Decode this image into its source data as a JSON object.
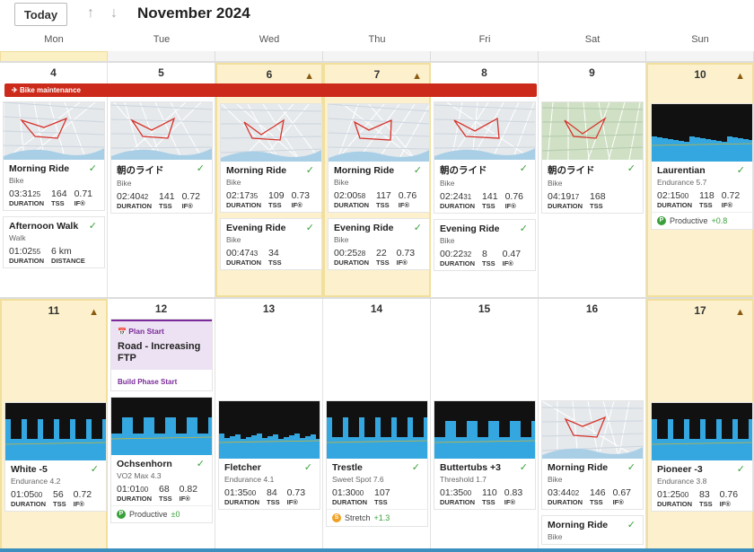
{
  "header": {
    "today_label": "Today",
    "up_icon": "arrow-up-icon",
    "down_icon": "arrow-down-icon",
    "month_title": "November 2024"
  },
  "weekdays": [
    "Mon",
    "Tue",
    "Wed",
    "Thu",
    "Fri",
    "Sat",
    "Sun"
  ],
  "colors": {
    "highlight": "#fcf1cc",
    "banner": "#cc2a1a",
    "plan": "#7a2a9a",
    "complete": "#3aa03a",
    "graph_fill": "#35a7e0"
  },
  "banner": {
    "icon": "plane-departure-icon",
    "label": "Bike maintenance"
  },
  "weeks": [
    {
      "days": [
        {
          "date": "4",
          "warning": false,
          "highlight": false,
          "items": [
            {
              "thumb": "map",
              "title": "Morning Ride",
              "subtitle": "Bike",
              "completed": true,
              "metrics": [
                {
                  "value": "03:31",
                  "sec": "25",
                  "label": "DURATION"
                },
                {
                  "value": "164",
                  "label": "TSS"
                },
                {
                  "value": "0.71",
                  "label": "IF®"
                }
              ]
            },
            {
              "thumb": "none",
              "title": "Afternoon Walk",
              "subtitle": "Walk",
              "completed": true,
              "metrics": [
                {
                  "value": "01:02",
                  "sec": "55",
                  "label": "DURATION"
                },
                {
                  "value": "6 km",
                  "label": "DISTANCE"
                }
              ]
            }
          ]
        },
        {
          "date": "5",
          "warning": false,
          "highlight": false,
          "items": [
            {
              "thumb": "map",
              "title": "朝のライド",
              "subtitle": "Bike",
              "completed": true,
              "metrics": [
                {
                  "value": "02:40",
                  "sec": "42",
                  "label": "DURATION"
                },
                {
                  "value": "141",
                  "label": "TSS"
                },
                {
                  "value": "0.72",
                  "label": "IF®"
                }
              ]
            }
          ]
        },
        {
          "date": "6",
          "warning": true,
          "highlight": true,
          "items": [
            {
              "thumb": "map",
              "title": "Morning Ride",
              "subtitle": "Bike",
              "completed": true,
              "metrics": [
                {
                  "value": "02:17",
                  "sec": "35",
                  "label": "DURATION"
                },
                {
                  "value": "109",
                  "label": "TSS"
                },
                {
                  "value": "0.73",
                  "label": "IF®"
                }
              ]
            },
            {
              "thumb": "none",
              "title": "Evening Ride",
              "subtitle": "Bike",
              "completed": true,
              "metrics": [
                {
                  "value": "00:47",
                  "sec": "43",
                  "label": "DURATION"
                },
                {
                  "value": "34",
                  "label": "TSS"
                }
              ]
            }
          ]
        },
        {
          "date": "7",
          "warning": true,
          "highlight": true,
          "items": [
            {
              "thumb": "map",
              "title": "Morning Ride",
              "subtitle": "Bike",
              "completed": true,
              "metrics": [
                {
                  "value": "02:00",
                  "sec": "58",
                  "label": "DURATION"
                },
                {
                  "value": "117",
                  "label": "TSS"
                },
                {
                  "value": "0.76",
                  "label": "IF®"
                }
              ]
            },
            {
              "thumb": "none",
              "title": "Evening Ride",
              "subtitle": "Bike",
              "completed": true,
              "metrics": [
                {
                  "value": "00:25",
                  "sec": "28",
                  "label": "DURATION"
                },
                {
                  "value": "22",
                  "label": "TSS"
                },
                {
                  "value": "0.73",
                  "label": "IF®"
                }
              ]
            }
          ]
        },
        {
          "date": "8",
          "warning": false,
          "highlight": false,
          "items": [
            {
              "thumb": "map",
              "title": "朝のライド",
              "subtitle": "Bike",
              "completed": true,
              "metrics": [
                {
                  "value": "02:24",
                  "sec": "31",
                  "label": "DURATION"
                },
                {
                  "value": "141",
                  "label": "TSS"
                },
                {
                  "value": "0.76",
                  "label": "IF®"
                }
              ]
            },
            {
              "thumb": "none",
              "title": "Evening Ride",
              "subtitle": "Bike",
              "completed": true,
              "metrics": [
                {
                  "value": "00:22",
                  "sec": "32",
                  "label": "DURATION"
                },
                {
                  "value": "8",
                  "label": "TSS"
                },
                {
                  "value": "0.47",
                  "label": "IF®"
                }
              ]
            }
          ]
        },
        {
          "date": "9",
          "warning": false,
          "highlight": false,
          "items": [
            {
              "thumb": "terrain",
              "title": "朝のライド",
              "subtitle": "Bike",
              "completed": true,
              "metrics": [
                {
                  "value": "04:19",
                  "sec": "17",
                  "label": "DURATION"
                },
                {
                  "value": "168",
                  "label": "TSS"
                }
              ]
            }
          ]
        },
        {
          "date": "10",
          "warning": true,
          "highlight": true,
          "items": [
            {
              "thumb": "graph",
              "title": "Laurentian",
              "subtitle": "Endurance 5.7",
              "completed": true,
              "metrics": [
                {
                  "value": "02:15",
                  "sec": "00",
                  "label": "DURATION"
                },
                {
                  "value": "118",
                  "label": "TSS"
                },
                {
                  "value": "0.72",
                  "label": "IF®"
                }
              ],
              "badge": {
                "icon": "P",
                "text": "Productive",
                "delta": "+0.8",
                "color": "#3aa03a"
              }
            }
          ]
        }
      ]
    },
    {
      "days": [
        {
          "date": "11",
          "warning": true,
          "highlight": true,
          "items": [
            {
              "thumb": "graph",
              "title": "White -5",
              "subtitle": "Endurance 4.2",
              "completed": true,
              "metrics": [
                {
                  "value": "01:05",
                  "sec": "00",
                  "label": "DURATION"
                },
                {
                  "value": "56",
                  "label": "TSS"
                },
                {
                  "value": "0.72",
                  "label": "IF®"
                }
              ]
            }
          ]
        },
        {
          "date": "12",
          "warning": false,
          "highlight": false,
          "plan": {
            "icon": "calendar-icon",
            "kicker": "Plan Start",
            "title": "Road - Increasing FTP",
            "footer": "Build Phase Start"
          },
          "items": [
            {
              "thumb": "graph",
              "title": "Ochsenhorn",
              "subtitle": "VO2 Max 4.3",
              "completed": true,
              "metrics": [
                {
                  "value": "01:01",
                  "sec": "00",
                  "label": "DURATION"
                },
                {
                  "value": "68",
                  "label": "TSS"
                },
                {
                  "value": "0.82",
                  "label": "IF®"
                }
              ],
              "badge": {
                "icon": "P",
                "text": "Productive",
                "delta": "±0",
                "color": "#3aa03a"
              }
            }
          ]
        },
        {
          "date": "13",
          "warning": false,
          "highlight": false,
          "items": [
            {
              "thumb": "graph",
              "title": "Fletcher",
              "subtitle": "Endurance 4.1",
              "completed": true,
              "metrics": [
                {
                  "value": "01:35",
                  "sec": "00",
                  "label": "DURATION"
                },
                {
                  "value": "84",
                  "label": "TSS"
                },
                {
                  "value": "0.73",
                  "label": "IF®"
                }
              ]
            }
          ]
        },
        {
          "date": "14",
          "warning": false,
          "highlight": false,
          "items": [
            {
              "thumb": "graph",
              "title": "Trestle",
              "subtitle": "Sweet Spot 7.6",
              "completed": true,
              "metrics": [
                {
                  "value": "01:30",
                  "sec": "00",
                  "label": "DURATION"
                },
                {
                  "value": "107",
                  "label": "TSS"
                }
              ],
              "badge": {
                "icon": "S",
                "text": "Stretch",
                "delta": "+1.3",
                "color": "#f0a020"
              }
            }
          ]
        },
        {
          "date": "15",
          "warning": false,
          "highlight": false,
          "items": [
            {
              "thumb": "graph",
              "title": "Buttertubs +3",
              "subtitle": "Threshold 1.7",
              "completed": true,
              "metrics": [
                {
                  "value": "01:35",
                  "sec": "00",
                  "label": "DURATION"
                },
                {
                  "value": "110",
                  "label": "TSS"
                },
                {
                  "value": "0.83",
                  "label": "IF®"
                }
              ]
            }
          ]
        },
        {
          "date": "16",
          "warning": false,
          "highlight": false,
          "items": [
            {
              "thumb": "map",
              "title": "Morning Ride",
              "subtitle": "Bike",
              "completed": true,
              "metrics": [
                {
                  "value": "03:44",
                  "sec": "02",
                  "label": "DURATION"
                },
                {
                  "value": "146",
                  "label": "TSS"
                },
                {
                  "value": "0.67",
                  "label": "IF®"
                }
              ]
            },
            {
              "thumb": "none",
              "title": "Morning Ride",
              "subtitle": "Bike",
              "completed": true,
              "metrics": []
            }
          ]
        },
        {
          "date": "17",
          "warning": true,
          "highlight": true,
          "items": [
            {
              "thumb": "graph",
              "title": "Pioneer -3",
              "subtitle": "Endurance 3.8",
              "completed": true,
              "metrics": [
                {
                  "value": "01:25",
                  "sec": "00",
                  "label": "DURATION"
                },
                {
                  "value": "83",
                  "label": "TSS"
                },
                {
                  "value": "0.76",
                  "label": "IF®"
                }
              ]
            }
          ]
        }
      ]
    }
  ]
}
